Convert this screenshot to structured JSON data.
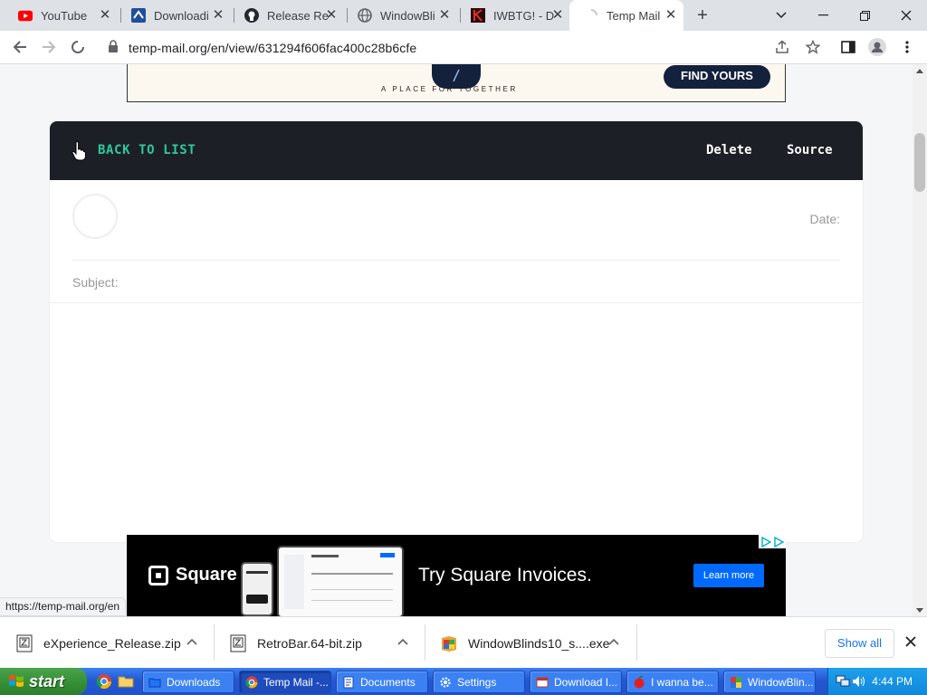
{
  "browser": {
    "tabs": [
      {
        "title": "YouTube",
        "icon": "youtube-icon",
        "active": false
      },
      {
        "title": "Downloadi",
        "icon": "download-site-icon",
        "active": false
      },
      {
        "title": "Release Re",
        "icon": "github-icon",
        "active": false
      },
      {
        "title": "WindowBli",
        "icon": "globe-icon",
        "active": false
      },
      {
        "title": "IWBTG! - D",
        "icon": "iwbtg-icon",
        "active": false
      },
      {
        "title": "Temp Mail",
        "icon": "loading-spinner-icon",
        "active": true
      }
    ],
    "url": "temp-mail.org/en/view/631294f606fac400c28b6cfe",
    "status_url": "https://temp-mail.org/en"
  },
  "top_ad": {
    "tagline": "A PLACE FOR TOGETHER",
    "button": "FIND YOURS"
  },
  "mail_view": {
    "back_label": "BACK TO LIST",
    "delete_label": "Delete",
    "source_label": "Source",
    "date_label": "Date:",
    "subject_label": "Subject:"
  },
  "bottom_ad": {
    "brand": "Square",
    "tagline": "Try Square Invoices.",
    "cta": "Learn more"
  },
  "downloads": {
    "items": [
      {
        "name": "eXperience_Release.zip",
        "icon": "zip-archive-icon"
      },
      {
        "name": "RetroBar.64-bit.zip",
        "icon": "zip-archive-icon"
      },
      {
        "name": "WindowBlinds10_s....exe",
        "icon": "installer-icon"
      }
    ],
    "show_all": "Show all"
  },
  "taskbar": {
    "start": "start",
    "tasks": [
      {
        "label": "Downloads",
        "active": false
      },
      {
        "label": "Temp Mail -...",
        "active": true
      },
      {
        "label": "Documents",
        "active": false
      },
      {
        "label": "Settings",
        "active": false
      },
      {
        "label": "Download I...",
        "active": false
      },
      {
        "label": "I wanna be...",
        "active": false
      },
      {
        "label": "WindowBlin...",
        "active": false
      }
    ],
    "clock": "4:44 PM"
  },
  "colors": {
    "accent": "#2ec9a0",
    "header_bg": "#1d1f26",
    "square_cta": "#006aff"
  }
}
